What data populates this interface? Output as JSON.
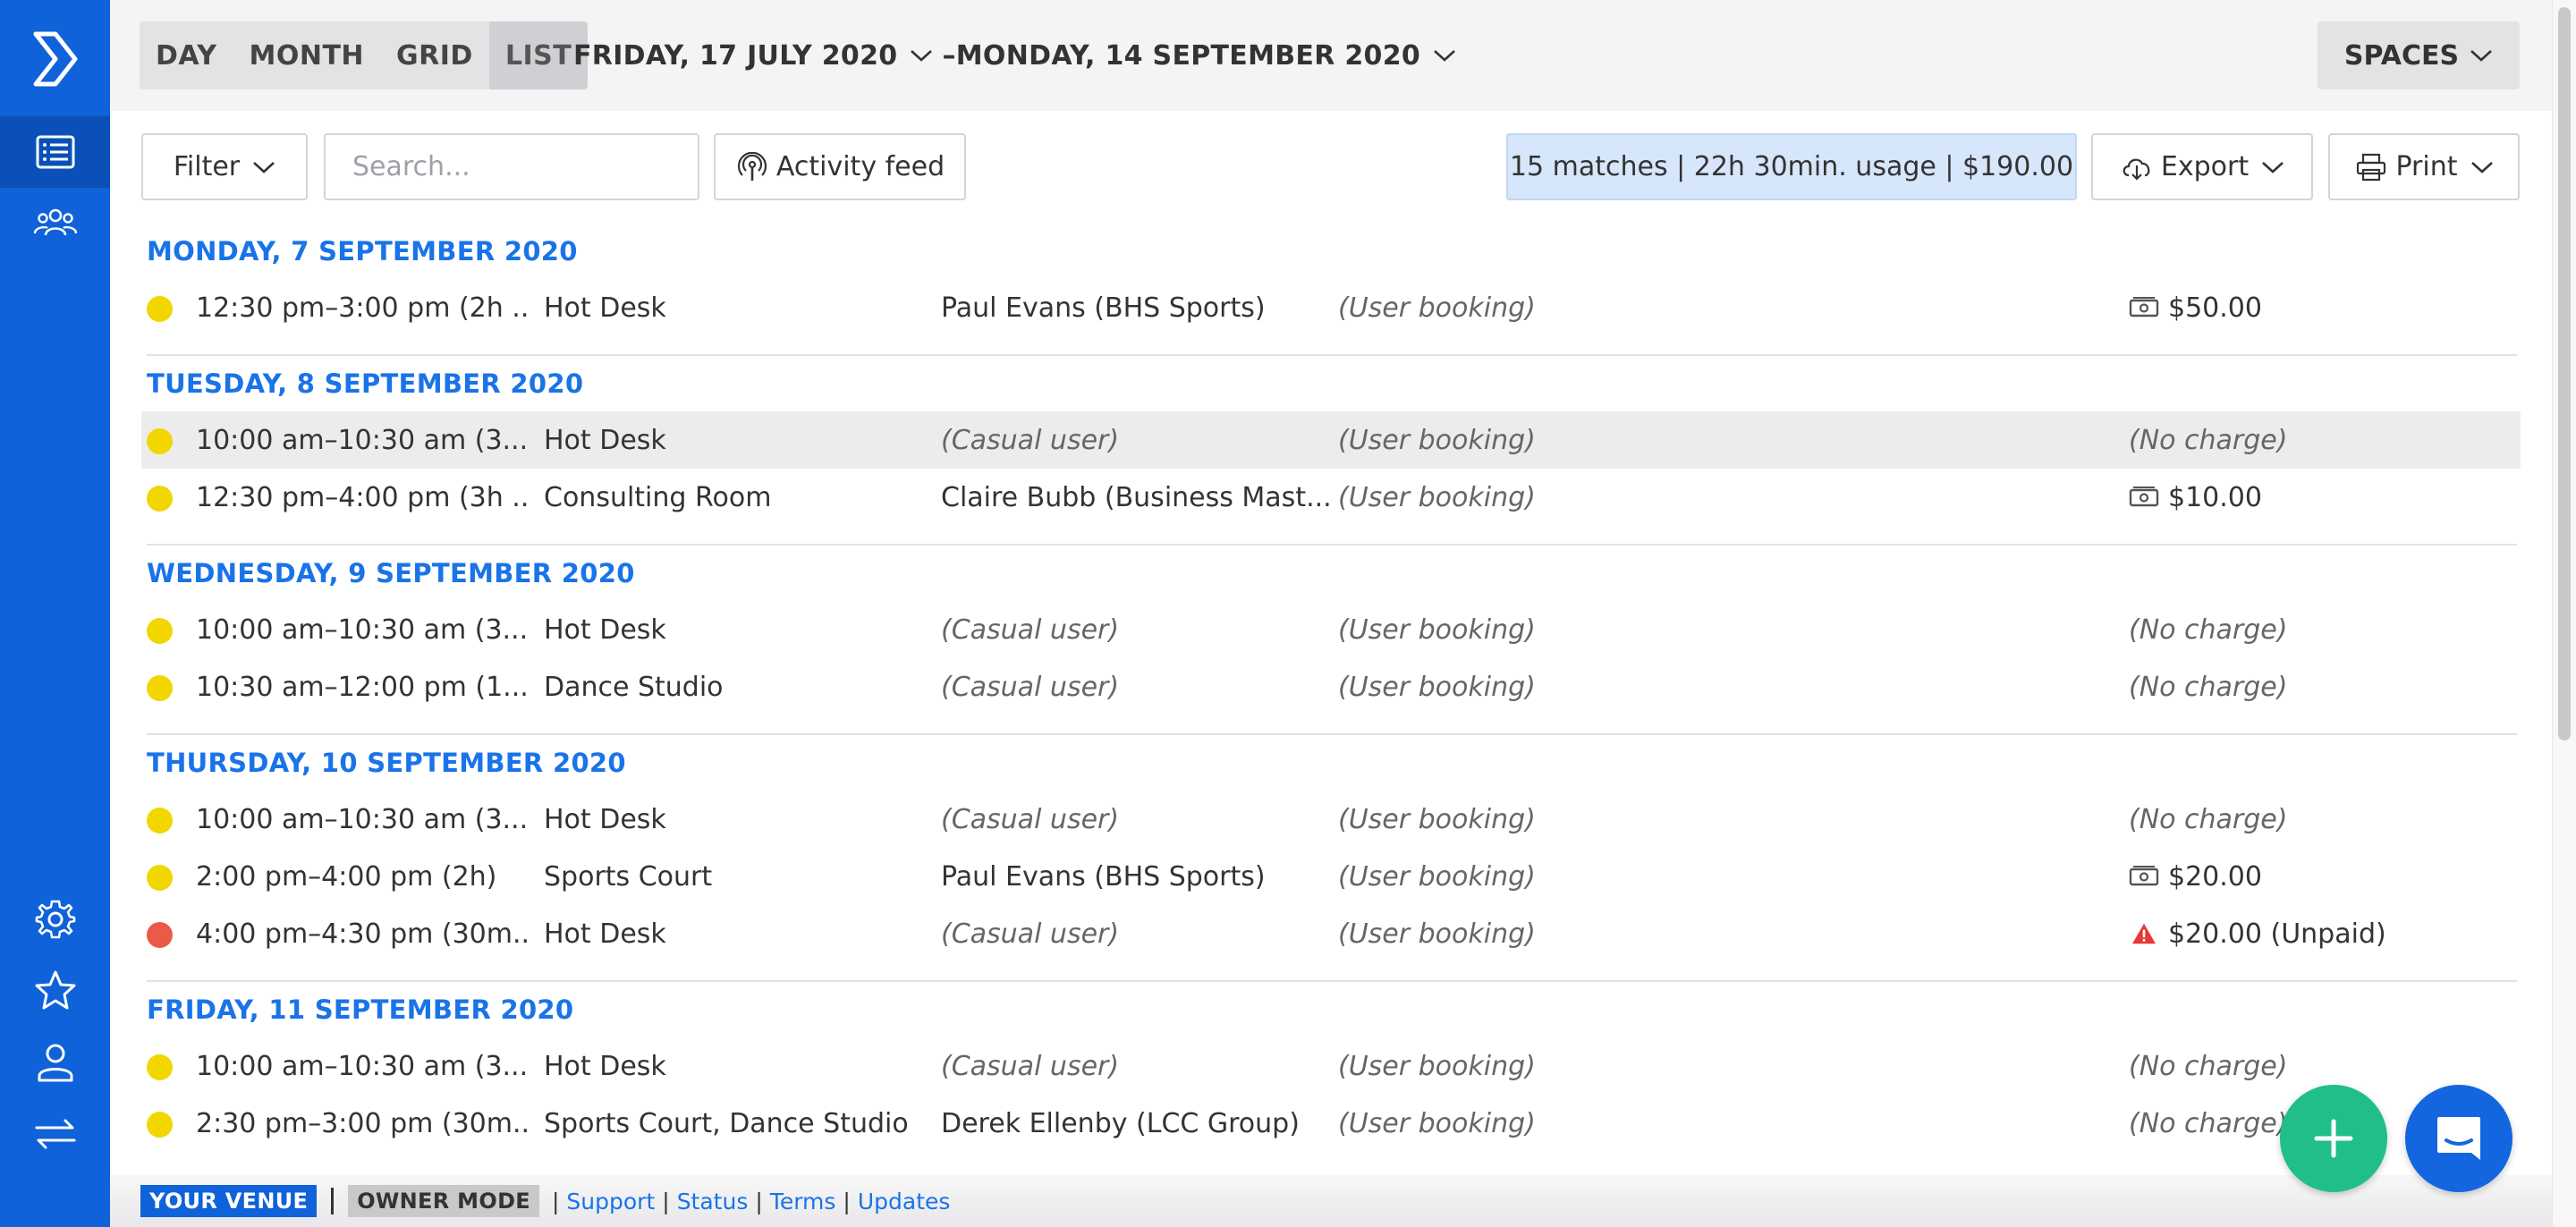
{
  "sidebar": {
    "logo_icon": "venue-logo-icon",
    "top_items": [
      {
        "icon": "list-icon",
        "active": true
      },
      {
        "icon": "users-icon",
        "active": false
      }
    ],
    "bottom_items": [
      {
        "icon": "gear-icon"
      },
      {
        "icon": "star-icon"
      },
      {
        "icon": "person-icon"
      },
      {
        "icon": "switch-icon"
      }
    ]
  },
  "topbar": {
    "views": [
      "DAY",
      "MONTH",
      "GRID",
      "LIST"
    ],
    "active_view": "LIST",
    "range_start": "FRIDAY, 17 JULY 2020",
    "range_sep": "–",
    "range_end": "MONDAY, 14 SEPTEMBER 2020",
    "spaces_label": "SPACES"
  },
  "toolbar": {
    "filter_label": "Filter",
    "search_placeholder": "Search...",
    "activity_label": "Activity feed",
    "summary": "15 matches | 22h 30min. usage | $190.00",
    "export_label": "Export",
    "print_label": "Print"
  },
  "colors": {
    "accent": "#0f62d9",
    "date_heading": "#1a73e8",
    "dot_yellow": "#f2d600",
    "dot_red": "#eb5a46",
    "fab_add": "#1fbf87",
    "warning": "#e53935"
  },
  "days": [
    {
      "date": "MONDAY, 7 SEPTEMBER 2020",
      "bookings": [
        {
          "status": "yellow",
          "time": "12:30 pm–3:00 pm (2h ...",
          "space": "Hot Desk",
          "user": "Paul Evans (BHS Sports)",
          "user_italic": false,
          "type": "(User booking)",
          "charge": "$50.00",
          "charge_icon": "cash-icon",
          "highlight": false
        }
      ]
    },
    {
      "date": "TUESDAY, 8 SEPTEMBER 2020",
      "bookings": [
        {
          "status": "yellow",
          "time": "10:00 am–10:30 am (3...",
          "space": "Hot Desk",
          "user": "(Casual user)",
          "user_italic": true,
          "type": "(User booking)",
          "charge": "(No charge)",
          "charge_icon": "",
          "highlight": true
        },
        {
          "status": "yellow",
          "time": "12:30 pm–4:00 pm (3h ...",
          "space": "Consulting Room",
          "user": "Claire Bubb (Business Mast...",
          "user_italic": false,
          "type": "(User booking)",
          "charge": "$10.00",
          "charge_icon": "cash-icon",
          "highlight": false
        }
      ]
    },
    {
      "date": "WEDNESDAY, 9 SEPTEMBER 2020",
      "bookings": [
        {
          "status": "yellow",
          "time": "10:00 am–10:30 am (3...",
          "space": "Hot Desk",
          "user": "(Casual user)",
          "user_italic": true,
          "type": "(User booking)",
          "charge": "(No charge)",
          "charge_icon": "",
          "highlight": false
        },
        {
          "status": "yellow",
          "time": "10:30 am–12:00 pm (1...",
          "space": "Dance Studio",
          "user": "(Casual user)",
          "user_italic": true,
          "type": "(User booking)",
          "charge": "(No charge)",
          "charge_icon": "",
          "highlight": false
        }
      ]
    },
    {
      "date": "THURSDAY, 10 SEPTEMBER 2020",
      "bookings": [
        {
          "status": "yellow",
          "time": "10:00 am–10:30 am (3...",
          "space": "Hot Desk",
          "user": "(Casual user)",
          "user_italic": true,
          "type": "(User booking)",
          "charge": "(No charge)",
          "charge_icon": "",
          "highlight": false
        },
        {
          "status": "yellow",
          "time": "2:00 pm–4:00 pm (2h)",
          "space": "Sports Court",
          "user": "Paul Evans (BHS Sports)",
          "user_italic": false,
          "type": "(User booking)",
          "charge": "$20.00",
          "charge_icon": "cash-icon",
          "highlight": false
        },
        {
          "status": "red",
          "time": "4:00 pm–4:30 pm (30m...",
          "space": "Hot Desk",
          "user": "(Casual user)",
          "user_italic": true,
          "type": "(User booking)",
          "charge": "$20.00 (Unpaid)",
          "charge_icon": "warning-icon",
          "highlight": false
        }
      ]
    },
    {
      "date": "FRIDAY, 11 SEPTEMBER 2020",
      "bookings": [
        {
          "status": "yellow",
          "time": "10:00 am–10:30 am (3...",
          "space": "Hot Desk",
          "user": "(Casual user)",
          "user_italic": true,
          "type": "(User booking)",
          "charge": "(No charge)",
          "charge_icon": "",
          "highlight": false
        },
        {
          "status": "yellow",
          "time": "2:30 pm–3:00 pm (30m...",
          "space": "Sports Court, Dance Studio",
          "user": "Derek Ellenby (LCC Group)",
          "user_italic": false,
          "type": "(User booking)",
          "charge": "(No charge)",
          "charge_icon": "",
          "highlight": false
        }
      ]
    }
  ],
  "footer": {
    "venue_badge": "YOUR VENUE",
    "owner_badge": "OWNER MODE",
    "links": [
      "Support",
      "Status",
      "Terms",
      "Updates"
    ]
  },
  "fab": {
    "add_icon": "plus-icon",
    "chat_icon": "chat-icon"
  }
}
